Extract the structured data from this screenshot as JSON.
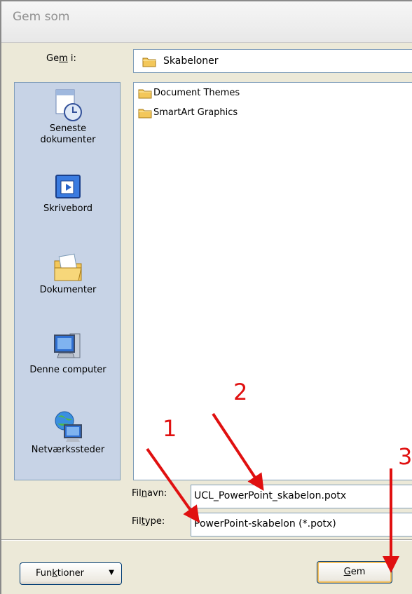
{
  "dialog": {
    "title": "Gem som"
  },
  "save_in": {
    "label_pre": "Ge",
    "label_u": "m",
    "label_post": " i:",
    "location": "Skabeloner"
  },
  "places": [
    {
      "label": "Seneste\ndokumenter",
      "icon": "recent-documents-icon"
    },
    {
      "label": "Skrivebord",
      "icon": "desktop-icon"
    },
    {
      "label": "Dokumenter",
      "icon": "documents-folder-icon"
    },
    {
      "label": "Denne computer",
      "icon": "computer-icon"
    },
    {
      "label": "Netværkssteder",
      "icon": "network-places-icon"
    }
  ],
  "files": [
    {
      "name": "Document Themes",
      "icon": "folder-icon"
    },
    {
      "name": "SmartArt Graphics",
      "icon": "folder-icon"
    }
  ],
  "filename": {
    "label_pre": "Fil",
    "label_u": "n",
    "label_post": "avn:",
    "value": "UCL_PowerPoint_skabelon.potx"
  },
  "filetype": {
    "label_pre": "Fil",
    "label_u": "t",
    "label_post": "ype:",
    "value": "PowerPoint-skabelon (*.potx)"
  },
  "buttons": {
    "tools_pre": "Fun",
    "tools_u": "k",
    "tools_post": "tioner",
    "save_u": "G",
    "save_post": "em"
  },
  "annotations": {
    "one": "1",
    "two": "2",
    "three": "3",
    "color": "#e01010"
  }
}
